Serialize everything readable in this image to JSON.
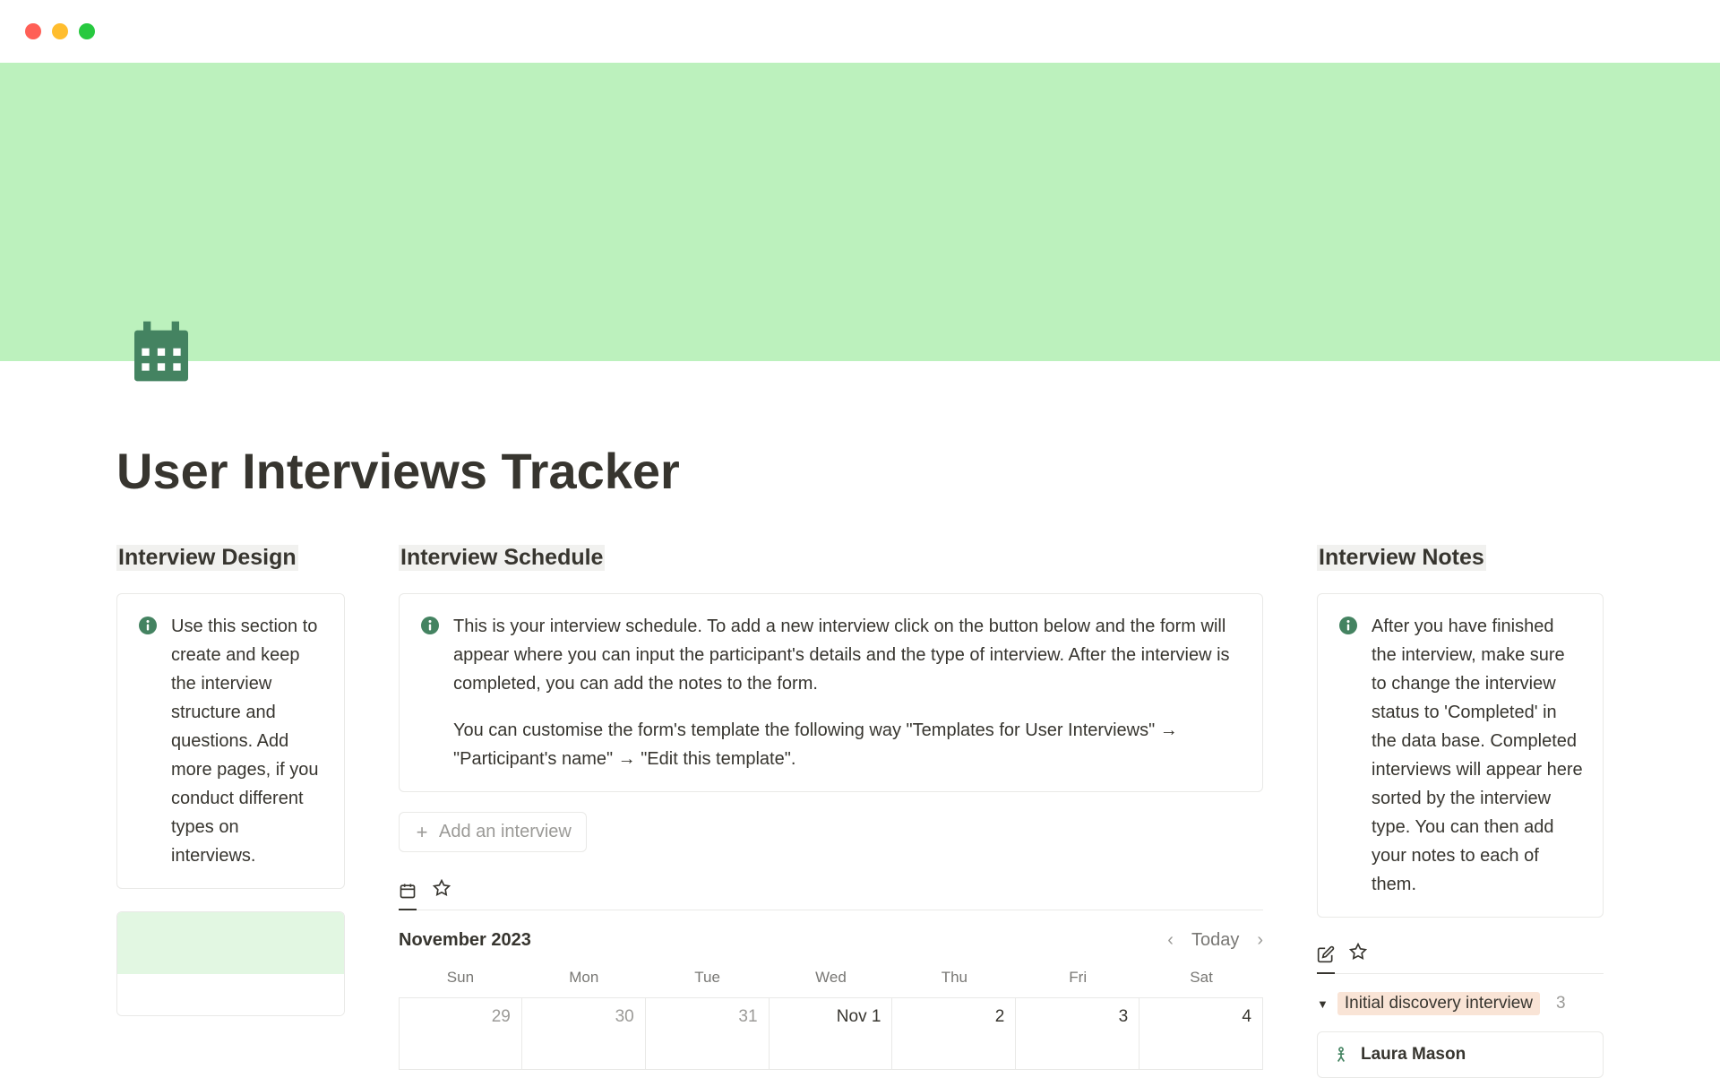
{
  "page": {
    "title": "User Interviews Tracker"
  },
  "columns": {
    "left": {
      "heading": "Interview Design",
      "callout": "Use this section to create and keep the interview structure and questions. Add more pages, if you conduct different types on interviews."
    },
    "middle": {
      "heading": "Interview Schedule",
      "callout_p1": "This is your interview schedule. To add a new interview click on the button below and the form will appear where you can input the participant's details and the type of interview. After the interview is completed, you can add the notes to the form.",
      "callout_p2": "You can customise the form's template the following way \"Templates for User Interviews\" → \"Participant's name\" → \"Edit this template\".",
      "add_button": "Add an interview",
      "calendar": {
        "month": "November 2023",
        "today": "Today",
        "days": [
          "Sun",
          "Mon",
          "Tue",
          "Wed",
          "Thu",
          "Fri",
          "Sat"
        ],
        "row1": [
          "29",
          "30",
          "31",
          "Nov 1",
          "2",
          "3",
          "4"
        ]
      }
    },
    "right": {
      "heading": "Interview Notes",
      "callout": "After you have finished the interview, make sure to change the interview status to 'Completed' in the data base. Completed interviews will appear here sorted by the interview type. You can then add your notes to each of them.",
      "group": {
        "name": "Initial discovery interview",
        "count": "3"
      },
      "note": {
        "name": "Laura Mason"
      }
    }
  }
}
